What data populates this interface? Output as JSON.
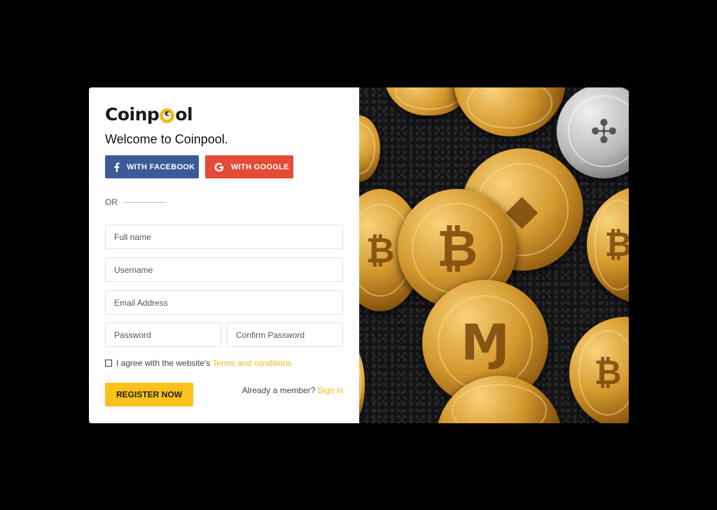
{
  "brand": {
    "logo_pre": "Coinp",
    "logo_post": "ol"
  },
  "welcome": "Welcome to Coinpool.",
  "social": {
    "facebook_label": "WITH FACEBOOK",
    "google_label": "WITH GOOGLE"
  },
  "divider_label": "OR",
  "form": {
    "full_name_placeholder": "Full name",
    "username_placeholder": "Username",
    "email_placeholder": "Email Address",
    "password_placeholder": "Password",
    "confirm_placeholder": "Confirm Password",
    "agree_text": "I agree with the website's",
    "terms_link": "Terms and conditions",
    "register_label": "REGISTER NOW",
    "member_text": "Already a member?",
    "signin_link": "Sign in"
  },
  "colors": {
    "accent": "#fcc21b",
    "facebook": "#3b5b98",
    "google": "#e34b36"
  }
}
